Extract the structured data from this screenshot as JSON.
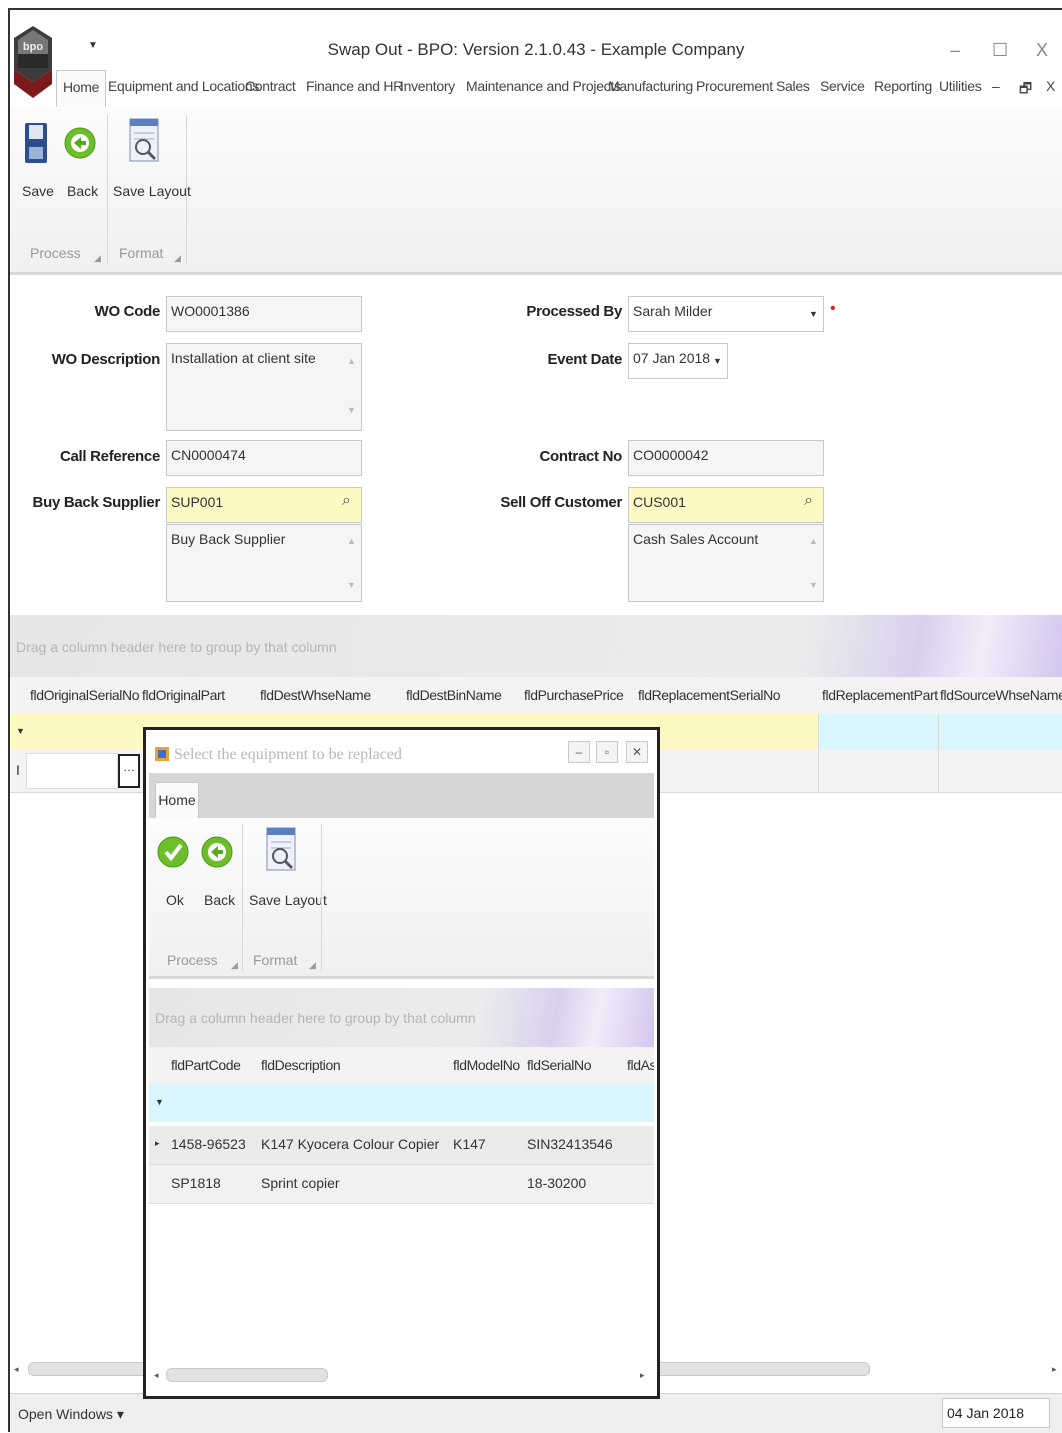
{
  "window": {
    "title": "Swap Out - BPO: Version 2.1.0.43 - Example Company",
    "minimize": "–",
    "maximize": "☐",
    "close": "X"
  },
  "menu": {
    "tabs": [
      "Home",
      "Equipment and Locations",
      "Contract",
      "Finance and HR",
      "Inventory",
      "Maintenance and Projects",
      "Manufacturing",
      "Procurement",
      "Sales",
      "Service",
      "Reporting",
      "Utilities"
    ],
    "right_controls": [
      "–",
      "🗗",
      "X"
    ]
  },
  "ribbon": {
    "save": "Save",
    "back": "Back",
    "save_layout": "Save Layout",
    "group_process": "Process",
    "group_format": "Format"
  },
  "form": {
    "wo_code_label": "WO Code",
    "wo_code": "WO0001386",
    "wo_description_label": "WO Description",
    "wo_description": "Installation at client site",
    "call_reference_label": "Call Reference",
    "call_reference": "CN0000474",
    "buy_back_supplier_label": "Buy Back Supplier",
    "buy_back_supplier": "SUP001",
    "buy_back_supplier_name": "Buy Back Supplier",
    "processed_by_label": "Processed By",
    "processed_by": "Sarah Milder",
    "event_date_label": "Event Date",
    "event_date": "07 Jan 2018",
    "contract_no_label": "Contract No",
    "contract_no": "CO0000042",
    "sell_off_customer_label": "Sell Off Customer",
    "sell_off_customer": "CUS001",
    "sell_off_customer_name": "Cash Sales Account"
  },
  "grid": {
    "group_hint": "Drag a column header here to group by that column",
    "columns": [
      "fldOriginalSerialNo",
      "fldOriginalPart",
      "fldDestWhseName",
      "fldDestBinName",
      "fldPurchasePrice",
      "fldReplacementSerialNo",
      "fldReplacementPart",
      "fldSourceWhseName"
    ],
    "ellipsis": "…"
  },
  "status": {
    "open_windows": "Open Windows ▾",
    "date": "04 Jan 2018"
  },
  "dialog": {
    "title": "Select the equipment to be replaced",
    "tab": "Home",
    "ok": "Ok",
    "back": "Back",
    "save_layout": "Save Layout",
    "group_process": "Process",
    "group_format": "Format",
    "group_hint": "Drag a column header here to group by that column",
    "columns": [
      "fldPartCode",
      "fldDescription",
      "fldModelNo",
      "fldSerialNo",
      "fldAs"
    ],
    "rows": [
      {
        "part_code": "1458-96523",
        "description": "K147 Kyocera Colour Copier",
        "model_no": "K147",
        "serial_no": "SIN32413546"
      },
      {
        "part_code": "SP1818",
        "description": "Sprint copier",
        "model_no": "",
        "serial_no": "18-30200"
      }
    ]
  }
}
